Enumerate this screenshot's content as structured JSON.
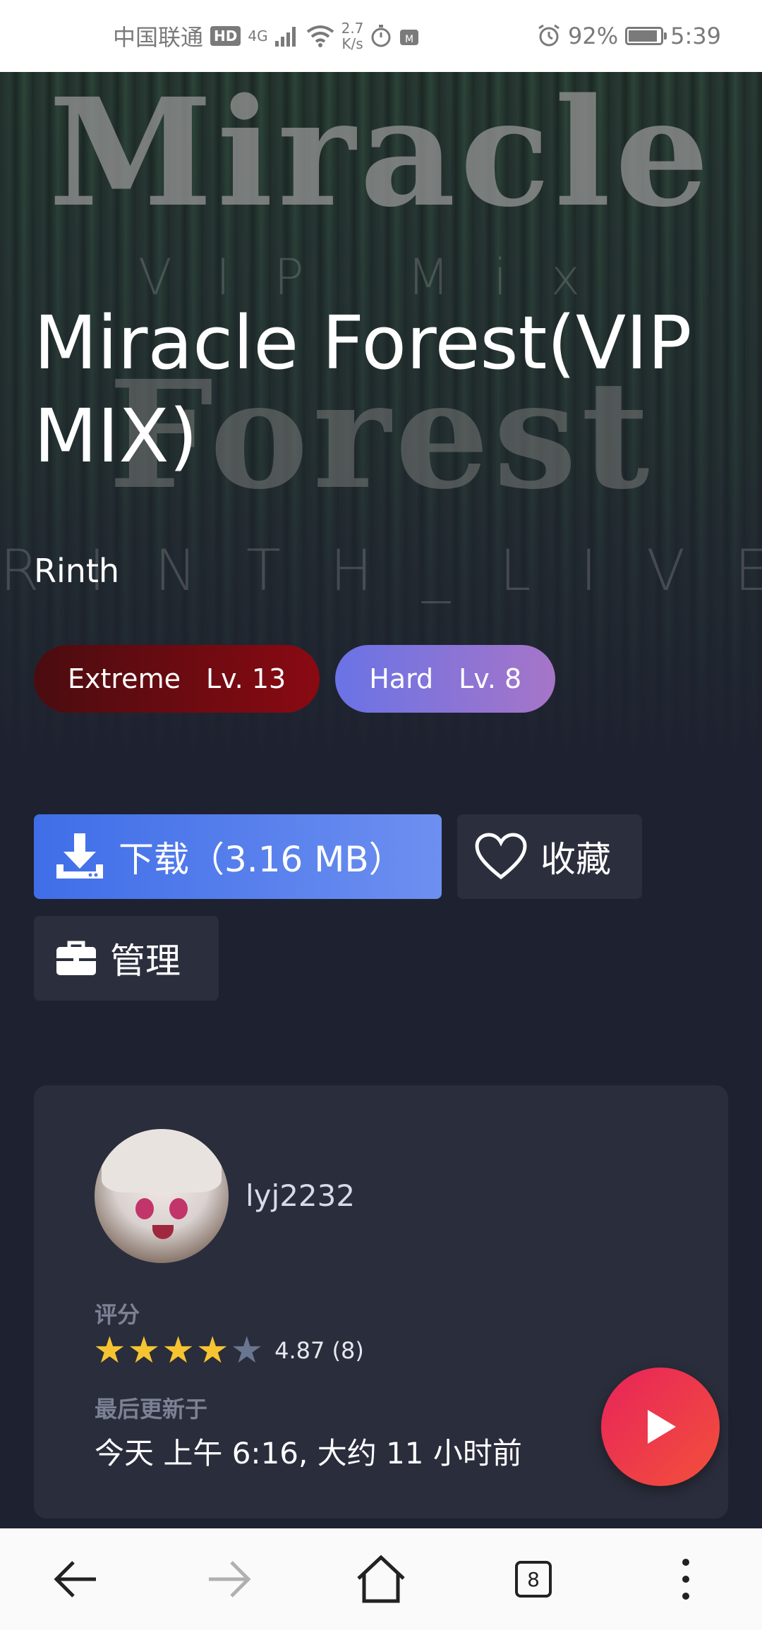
{
  "status_bar": {
    "carrier": "中国联通",
    "hd": "HD",
    "signal": "4G",
    "net_speed_value": "2.7",
    "net_speed_unit": "K/s",
    "battery_percent": "92%",
    "battery_level": 0.92,
    "time": "5:39"
  },
  "hero": {
    "art_title_1": "Miracle",
    "art_sub": "VIP Mix",
    "art_title_2": "Forest",
    "art_artist": "RINTH_LIVE"
  },
  "song": {
    "title": "Miracle Forest(VIP MIX)",
    "artist": "Rinth"
  },
  "difficulties": [
    {
      "name": "Extreme",
      "level": "Lv. 13"
    },
    {
      "name": "Hard",
      "level": "Lv. 8"
    }
  ],
  "actions": {
    "download_label": "下载（3.16 MB）",
    "favorite_label": "收藏",
    "manage_label": "管理"
  },
  "uploader": {
    "username": "lyj2232"
  },
  "rating": {
    "label": "评分",
    "value_text": "4.87 (8)",
    "stars_filled": 4,
    "stars_total": 5
  },
  "updated": {
    "label": "最后更新于",
    "value": "今天 上午 6:16, 大约 11 小时前"
  },
  "browser_bar": {
    "tab_count": "8"
  },
  "colors": {
    "accent_blue": "#3f6ee8",
    "fab_red": "#e8245a",
    "star_yellow": "#f6c431"
  }
}
